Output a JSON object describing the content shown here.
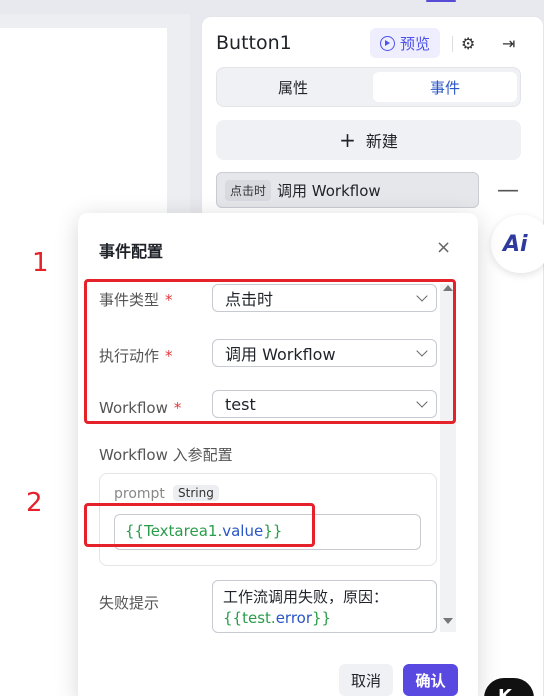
{
  "panel": {
    "component_name": "Button1",
    "preview_label": "预览",
    "tabs": [
      "属性",
      "事件"
    ],
    "new_label": "新建",
    "event_item": {
      "trigger": "点击时",
      "action": "调用 Workflow"
    }
  },
  "dialog": {
    "title": "事件配置",
    "event_type_label": "事件类型",
    "event_type_value": "点击时",
    "action_label": "执行动作",
    "action_value": "调用 Workflow",
    "workflow_label": "Workflow",
    "workflow_value": "test",
    "params_section_label": "Workflow 入参配置",
    "param": {
      "name": "prompt",
      "type": "String",
      "value_open": "{{",
      "value_obj": "Textarea1",
      "value_dot": ".",
      "value_prop": "value",
      "value_close": "}}"
    },
    "fail_label": "失败提示",
    "fail_text_line1": "工作流调用失败，原因：",
    "fail_var": {
      "open": "{{",
      "obj": "test",
      "dot": ".",
      "prop": "error",
      "close": "}}"
    },
    "required_mark": "*",
    "cancel_label": "取消",
    "confirm_label": "确认"
  },
  "annotations": [
    "1",
    "2"
  ],
  "badges": {
    "ai": "Ai",
    "bottom": "K"
  },
  "colors": {
    "accent": "#5a49e0",
    "annotation": "#e5222a",
    "variable_green": "#2a9d4a",
    "variable_blue": "#2a56c6"
  }
}
